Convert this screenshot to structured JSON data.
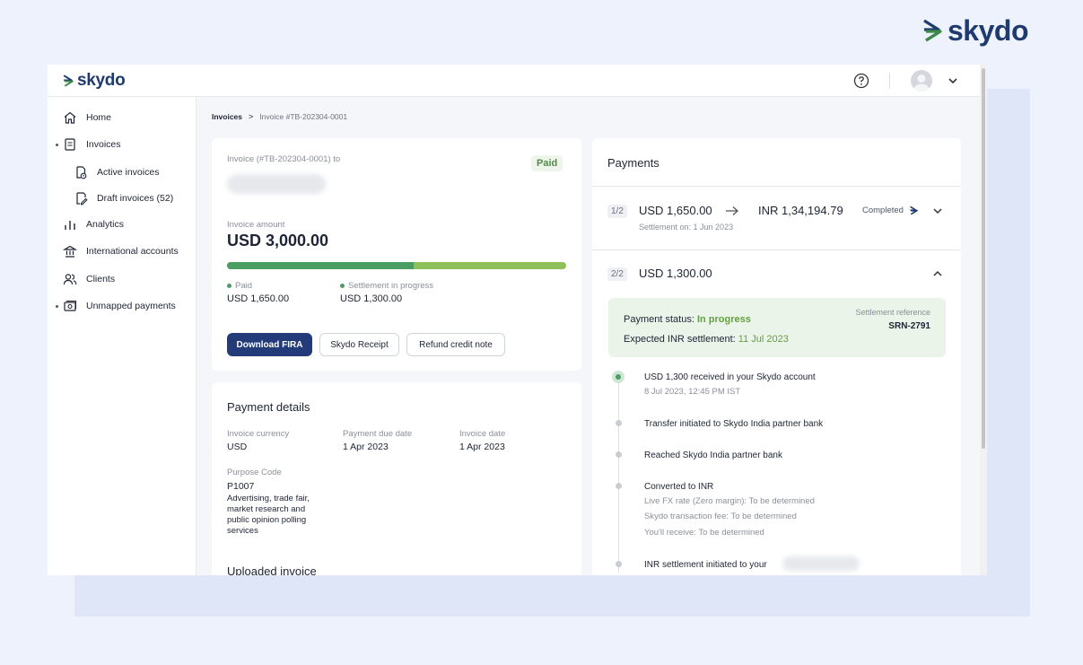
{
  "brand": {
    "name": "skydo"
  },
  "app": {
    "logo": "skydo",
    "sidebar": {
      "items": [
        {
          "label": "Home",
          "icon": "home-icon"
        },
        {
          "label": "Invoices",
          "icon": "invoice-icon"
        },
        {
          "label": "Active invoices",
          "icon": "active-invoice-icon"
        },
        {
          "label": "Draft invoices (52)",
          "icon": "draft-invoice-icon"
        },
        {
          "label": "Analytics",
          "icon": "analytics-icon"
        },
        {
          "label": "International accounts",
          "icon": "bank-icon"
        },
        {
          "label": "Clients",
          "icon": "clients-icon"
        },
        {
          "label": "Unmapped payments",
          "icon": "cash-icon"
        }
      ]
    },
    "breadcrumb": {
      "parent": "Invoices",
      "separator": ">",
      "current": "Invoice #TB-202304-0001"
    },
    "invoice": {
      "title": "Invoice (#TB-202304-0001) to",
      "status": "Paid",
      "amount_label": "Invoice amount",
      "amount": "USD 3,000.00",
      "progress_paid_fraction": 0.55,
      "paid_label": "Paid",
      "paid_value": "USD 1,650.00",
      "settlement_label": "Settlement in progress",
      "settlement_value": "USD 1,300.00",
      "buttons": {
        "download": "Download FIRA",
        "receipt": "Skydo Receipt",
        "refund": "Refund credit note"
      }
    },
    "payment_details": {
      "title": "Payment details",
      "currency_label": "Invoice currency",
      "currency_value": "USD",
      "due_label": "Payment due date",
      "due_value": "1 Apr 2023",
      "date_label": "Invoice date",
      "date_value": "1 Apr 2023",
      "purpose_label": "Purpose Code",
      "purpose_code": "P1007",
      "purpose_desc_1": "Advertising, trade fair,",
      "purpose_desc_2": "market research and",
      "purpose_desc_3": "public opinion polling",
      "purpose_desc_4": "services",
      "uploaded_title": "Uploaded invoice"
    },
    "payments": {
      "title": "Payments",
      "row1": {
        "index": "1/2",
        "usd": "USD 1,650.00",
        "inr": "INR 1,34,194.79",
        "status": "Completed",
        "settlement": "Settlement on: 1 Jun 2023"
      },
      "row2": {
        "index": "2/2",
        "usd": "USD 1,300.00"
      },
      "status_box": {
        "status_label": "Payment status:",
        "status_value": "In progress",
        "expected_label": "Expected INR settlement:",
        "expected_value": "11 Jul 2023",
        "ref_label": "Settlement reference",
        "ref_value": "SRN-2791"
      },
      "timeline": [
        {
          "title": "USD 1,300 received in your Skydo account",
          "sub": "8 Jul 2023, 12:45 PM IST"
        },
        {
          "title": "Transfer initiated to Skydo India partner bank"
        },
        {
          "title": "Reached Skydo India partner bank"
        },
        {
          "title": "Converted to INR",
          "sub1": "Live FX rate (Zero margin): To be determined",
          "sub2": "Skydo transaction fee: To be determined",
          "sub3": "You'll receive: To be determined"
        },
        {
          "title": "INR settlement initiated to your"
        }
      ]
    }
  },
  "colors": {
    "brand_navy": "#1e3a6e",
    "brand_green": "#3c8a4a",
    "primary_button": "#233b79",
    "paid_green": "#4a9e64",
    "settle_green": "#8ec15a"
  }
}
